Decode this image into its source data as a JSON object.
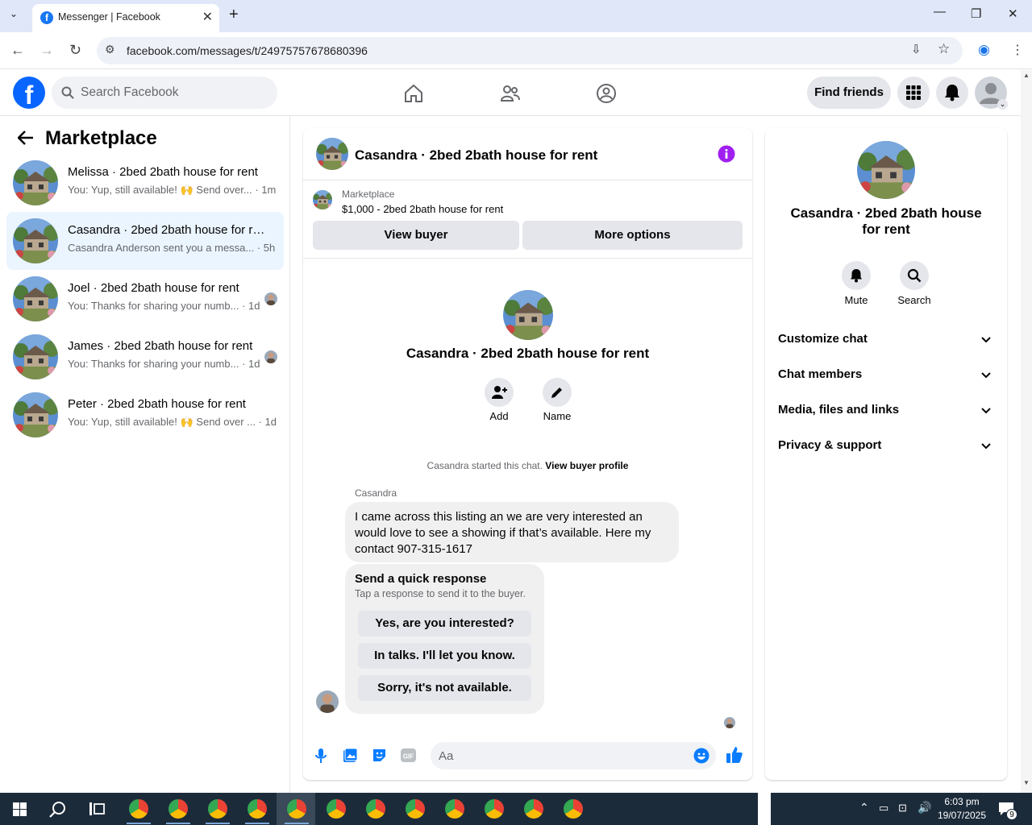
{
  "browser": {
    "tab_title": "Messenger | Facebook",
    "url": "facebook.com/messages/t/24975757678680396"
  },
  "fb": {
    "search_placeholder": "Search Facebook",
    "find_friends": "Find friends"
  },
  "left": {
    "title": "Marketplace",
    "conversations": [
      {
        "name": "Melissa · 2bed 2bath house for rent",
        "preview": "You: Yup, still available! 🙌 Send over... · 1m"
      },
      {
        "name": "Casandra · 2bed 2bath house for rent",
        "preview": "Casandra Anderson sent you a messa... · 5h"
      },
      {
        "name": "Joel · 2bed 2bath house for rent",
        "preview": "You: Thanks for sharing your numb... · 1d"
      },
      {
        "name": "James · 2bed 2bath house for rent",
        "preview": "You: Thanks for sharing your numb... · 1d"
      },
      {
        "name": "Peter · 2bed 2bath house for rent",
        "preview": "You: Yup, still available! 🙌 Send over ... · 1d"
      }
    ]
  },
  "chat": {
    "header_name": "Casandra · 2bed 2bath house for rent",
    "marketplace_label": "Marketplace",
    "listing": "$1,000 - 2bed 2bath house for rent",
    "view_buyer": "View buyer",
    "more_options": "More options",
    "center_name": "Casandra · 2bed 2bath house for rent",
    "add_label": "Add",
    "name_label": "Name",
    "started_text": "Casandra started this chat. ",
    "view_buyer_profile": "View buyer profile",
    "sender": "Casandra",
    "message": "I came across this listing an we are very interested an would love to see a showing if that’s available. Here my contact 907-315-1617",
    "quick_title": "Send a quick response",
    "quick_sub": "Tap a response to send it to the buyer.",
    "quick_responses": [
      "Yes, are you interested?",
      "In talks. I'll let you know.",
      "Sorry, it's not available."
    ],
    "composer_placeholder": "Aa"
  },
  "right": {
    "name": "Casandra · 2bed 2bath house for rent",
    "mute": "Mute",
    "search": "Search",
    "sections": [
      "Customize chat",
      "Chat members",
      "Media, files and links",
      "Privacy & support"
    ]
  },
  "taskbar": {
    "time": "6:03 pm",
    "date": "19/07/2025",
    "notif_count": "9"
  },
  "colors": {
    "fb_blue": "#0866ff",
    "active_conv": "#ebf5ff",
    "info_purple": "#a020f0",
    "messenger_blue": "#0a7cff"
  }
}
